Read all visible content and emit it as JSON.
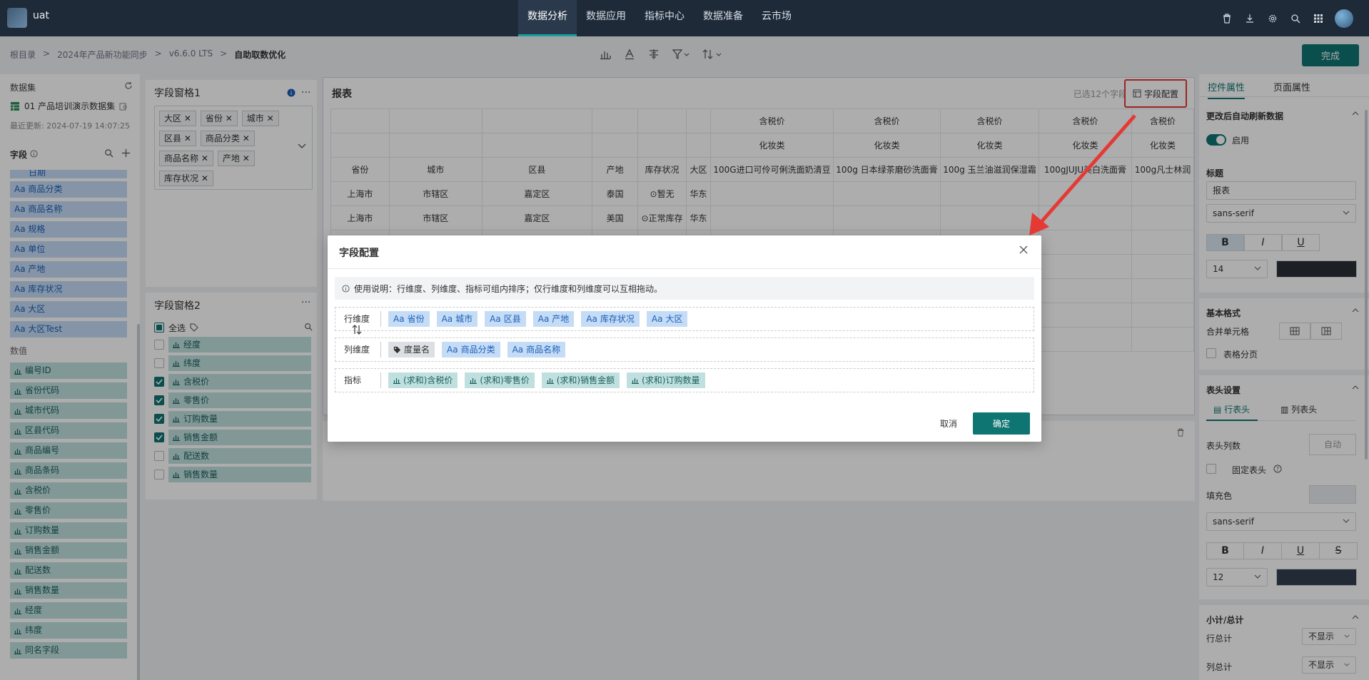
{
  "topbar": {
    "app_name": "uat",
    "nav": [
      {
        "label": "数据分析",
        "active": true
      },
      {
        "label": "数据应用"
      },
      {
        "label": "指标中心"
      },
      {
        "label": "数据准备"
      },
      {
        "label": "云市场"
      }
    ],
    "icons": [
      "trash-icon",
      "download-icon",
      "gear-icon",
      "search-icon",
      "grid-icon",
      "avatar"
    ]
  },
  "breadcrumb": [
    "根目录",
    ">",
    "2024年产品新功能同步",
    ">",
    "v6.6.0 LTS",
    ">",
    "自助取数优化"
  ],
  "toolbar": {
    "done_label": "完成",
    "icons": [
      "chart-icon",
      "text-icon",
      "align-icon",
      "filter-icon",
      "sort-icon"
    ]
  },
  "left": {
    "title": "数据集",
    "dataset": "01 产品培训演示数据集",
    "updated": "最近更新: 2024-07-19 14:07:25",
    "field_label": "字段",
    "dims_partial": "日期",
    "dims": [
      "商品分类",
      "商品名称",
      "规格",
      "单位",
      "产地",
      "库存状况",
      "大区",
      "大区Test"
    ],
    "measures_label": "数值",
    "measures": [
      "编号ID",
      "省份代码",
      "城市代码",
      "区县代码",
      "商品编号",
      "商品条码",
      "含税价",
      "零售价",
      "订购数量",
      "销售金额",
      "配送数",
      "销售数量",
      "经度",
      "纬度",
      "同名字段"
    ]
  },
  "pane1": {
    "title": "字段窗格1",
    "tags": [
      "大区",
      "省份",
      "城市",
      "区县",
      "商品分类",
      "商品名称",
      "产地",
      "库存状况"
    ]
  },
  "pane2": {
    "title": "字段窗格2",
    "select_all": "全选",
    "items": [
      {
        "label": "经度",
        "checked": false
      },
      {
        "label": "纬度",
        "checked": false
      },
      {
        "label": "含税价",
        "checked": true
      },
      {
        "label": "零售价",
        "checked": true
      },
      {
        "label": "订购数量",
        "checked": true
      },
      {
        "label": "销售金额",
        "checked": true
      },
      {
        "label": "配送数",
        "checked": false
      },
      {
        "label": "销售数量",
        "checked": false
      }
    ]
  },
  "report": {
    "title": "报表",
    "selected_count": "已选12个字段",
    "field_config_btn": "字段配置",
    "header_row1": [
      "含税价",
      "含税价",
      "含税价",
      "含税价",
      "含税价"
    ],
    "header_row2": [
      "化妆类",
      "化妆类",
      "化妆类",
      "化妆类",
      "化妆类"
    ],
    "header_row3": [
      "省份",
      "城市",
      "区县",
      "产地",
      "库存状况",
      "大区",
      "100G进口可伶可俐洗面奶清豆",
      "100g 日本绿茶磨砂洗面膏",
      "100g 玉兰油滋润保湿霜",
      "100gJUJU美白洗面膏",
      "100g凡士林润"
    ],
    "rows": [
      [
        "上海市",
        "市辖区",
        "嘉定区",
        "泰国",
        "⊙暂无",
        "华东"
      ],
      [
        "上海市",
        "市辖区",
        "嘉定区",
        "美国",
        "⊙正常库存",
        "华东"
      ]
    ]
  },
  "right": {
    "tabs": [
      "控件属性",
      "页面属性"
    ],
    "auto_refresh": "更改后自动刷新数据",
    "enable": "启用",
    "title_label": "标题",
    "title_value": "报表",
    "font": "sans-serif",
    "size1": "14",
    "basic_fmt": "基本格式",
    "merge_cells": "合并单元格",
    "table_paging": "表格分页",
    "header_settings": "表头设置",
    "row_header": "行表头",
    "col_header": "列表头",
    "header_cols": "表头列数",
    "auto": "自动",
    "fixed_header": "固定表头",
    "fill_color": "填充色",
    "font2": "sans-serif",
    "size2": "12",
    "subtotal": "小计/总计",
    "row_total": "行总计",
    "col_total": "列总计",
    "no_show": "不显示",
    "bold": "B",
    "italic": "I",
    "underline": "U",
    "strike": "S"
  },
  "modal": {
    "title": "字段配置",
    "info": "使用说明：行维度、列维度、指标可组内排序；仅行维度和列维度可以互相拖动。",
    "row_dim_label": "行维度",
    "row_dims": [
      "省份",
      "城市",
      "区县",
      "产地",
      "库存状况",
      "大区"
    ],
    "col_dim_label": "列维度",
    "col_measure_name": "度量名",
    "col_dims": [
      "商品分类",
      "商品名称"
    ],
    "metric_label": "指标",
    "metrics": [
      "(求和)含税价",
      "(求和)零售价",
      "(求和)销售金额",
      "(求和)订购数量"
    ],
    "cancel": "取消",
    "ok": "确定"
  },
  "colors": {
    "brand": "#0f7572",
    "dim": "#c5dcf7",
    "measure": "#bfe0df",
    "highlight": "#e53935"
  }
}
